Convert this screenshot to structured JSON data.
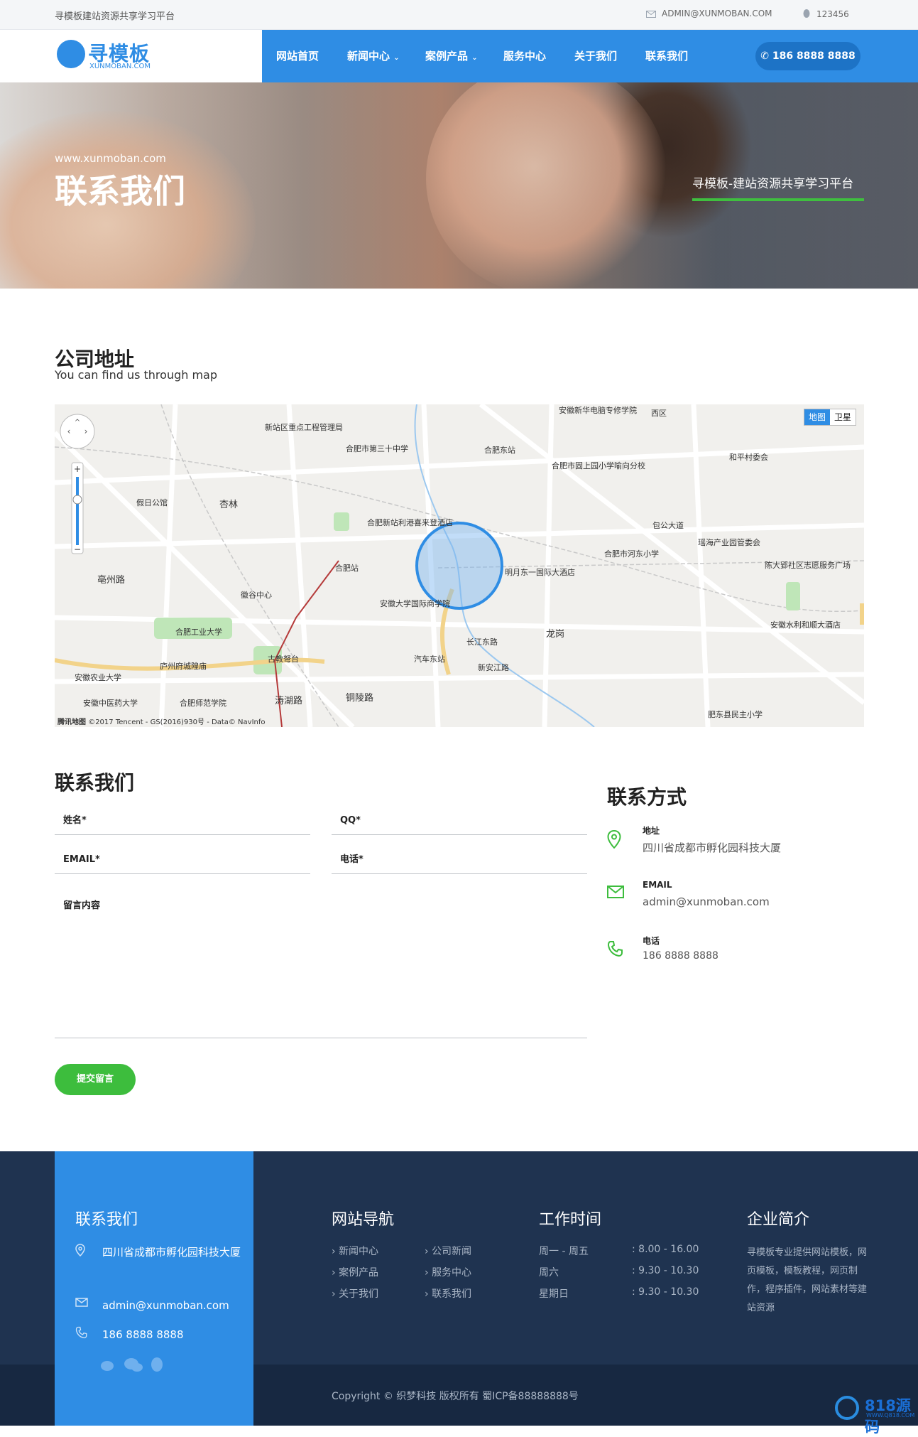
{
  "topbar": {
    "site_name": "寻模板建站资源共享学习平台",
    "email": "ADMIN@XUNMOBAN.COM",
    "qq": "123456"
  },
  "logo": {
    "cn": "寻模板",
    "en": "XUNMOBAN.COM"
  },
  "nav": {
    "items": [
      {
        "label": "网站首页"
      },
      {
        "label": "新闻中心"
      },
      {
        "label": "案例产品"
      },
      {
        "label": "服务中心"
      },
      {
        "label": "关于我们"
      },
      {
        "label": "联系我们"
      }
    ],
    "phone": "186 8888 8888"
  },
  "hero": {
    "site": "www.xunmoban.com",
    "title": "联系我们",
    "slogan": "寻模板-建站资源共享学习平台"
  },
  "address_section": {
    "title": "公司地址",
    "subtitle": "You can find us through map"
  },
  "map": {
    "tabs": [
      "地图",
      "卫星"
    ],
    "copyright": "©2017 Tencent - GS(2016)930号 - Data© NavInfo",
    "brand": "腾讯地图",
    "labels": [
      "安徽新华电脑专修学院",
      "西区",
      "新站区重点工程管理局",
      "合肥市第三十中学",
      "合肥东站",
      "合肥市固上园小学喻向分校",
      "和平村委会",
      "杏林",
      "假日公馆",
      "合肥新站利港喜来登酒店",
      "包公大道",
      "瑶海产业园管委会",
      "陈大郢社区志愿服务广场",
      "亳州路",
      "合肥站",
      "明月东一国际大酒店",
      "合肥市河东小学",
      "徽谷中心",
      "安徽大学国际商学院",
      "龙岗",
      "安徽水利和顺大酒店",
      "合肥工业大学",
      "古教弩台",
      "长江东路",
      "汽车东站",
      "庐州府城隍庙",
      "安徽农业大学",
      "新安江路",
      "铜陵路",
      "安徽中医药大学",
      "合肥师范学院",
      "肥东县民主小学",
      "涛湖路"
    ]
  },
  "form": {
    "title": "联系我们",
    "name_ph": "姓名*",
    "qq_ph": "QQ*",
    "email_ph": "EMAIL*",
    "phone_ph": "电话*",
    "message_ph": "留言内容",
    "submit": "提交留言"
  },
  "contact_way": {
    "title": "联系方式",
    "address_label": "地址",
    "address": "四川省成都市孵化园科技大厦",
    "email_label": "EMAIL",
    "email": "admin@xunmoban.com",
    "phone_label": "电话",
    "phone": "186 8888 8888"
  },
  "footer": {
    "contact": {
      "title": "联系我们",
      "address": "四川省成都市孵化园科技大厦",
      "email": "admin@xunmoban.com",
      "phone": "186 8888 8888"
    },
    "nav": {
      "title": "网站导航",
      "links": [
        "新闻中心",
        "公司新闻",
        "案例产品",
        "服务中心",
        "关于我们",
        "联系我们"
      ]
    },
    "hours": {
      "title": "工作时间",
      "rows": [
        {
          "day": "周一 - 周五",
          "time": ": 8.00 - 16.00"
        },
        {
          "day": "周六",
          "time": ": 9.30 - 10.30"
        },
        {
          "day": "星期日",
          "time": ": 9.30 - 10.30"
        }
      ]
    },
    "intro": {
      "title": "企业简介",
      "text": "寻模板专业提供网站模板，网页模板，模板教程，网页制作，程序插件，网站素材等建站资源"
    },
    "copyright": "Copyright © 织梦科技 版权所有 蜀ICP备88888888号"
  },
  "badge": {
    "title": "818源码",
    "sub": "WWW.Q818.COM"
  }
}
